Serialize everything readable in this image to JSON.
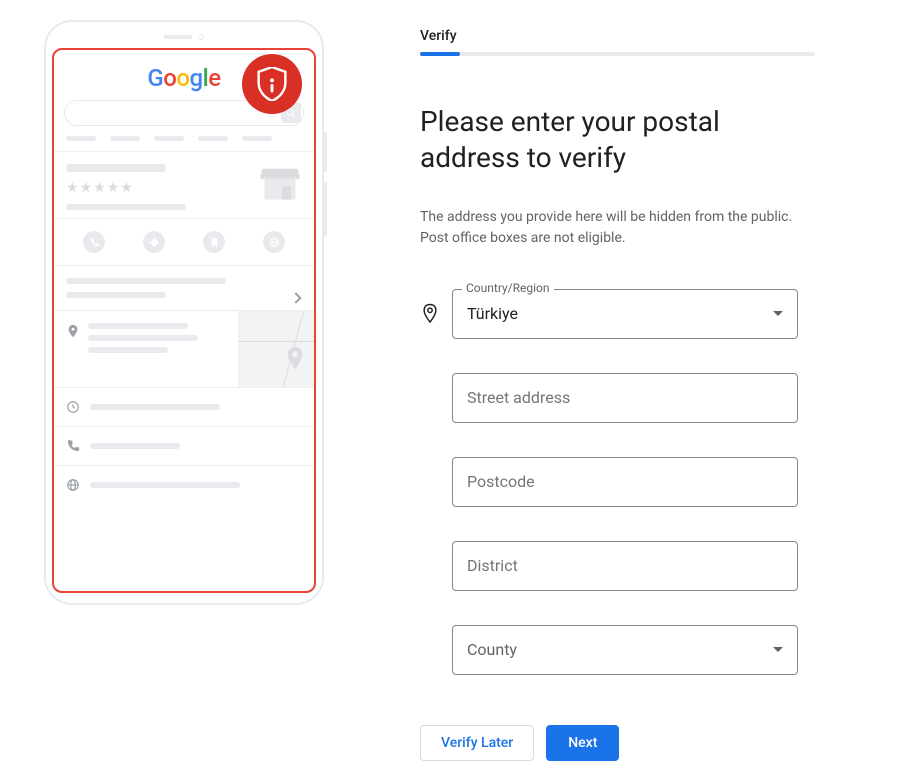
{
  "step": {
    "label": "Verify"
  },
  "heading": "Please enter your postal address to verify",
  "description": "The address you provide here will be hidden from the public. Post office boxes are not eligible.",
  "form": {
    "country": {
      "label": "Country/Region",
      "value": "Türkiye"
    },
    "street": {
      "placeholder": "Street address"
    },
    "postcode": {
      "placeholder": "Postcode"
    },
    "district": {
      "placeholder": "District"
    },
    "county": {
      "placeholder": "County"
    }
  },
  "actions": {
    "verify_later": "Verify Later",
    "next": "Next"
  },
  "illustration": {
    "logo_letters": [
      "G",
      "o",
      "o",
      "g",
      "l",
      "e"
    ]
  }
}
